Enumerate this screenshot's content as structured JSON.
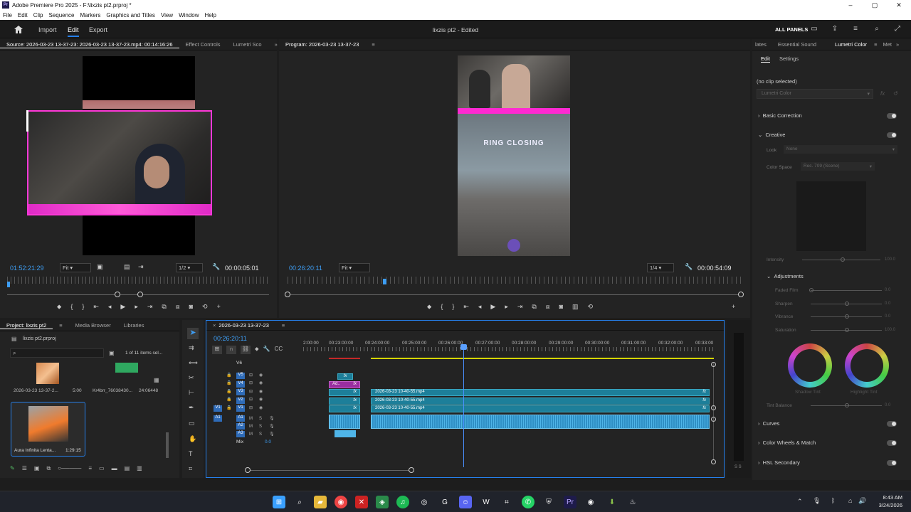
{
  "titlebar": {
    "title": "Adobe Premiere Pro 2025 - F:\\lixzis pt2.prproj *"
  },
  "menu": [
    "File",
    "Edit",
    "Clip",
    "Sequence",
    "Markers",
    "Graphics and Titles",
    "View",
    "Window",
    "Help"
  ],
  "header": {
    "nav": [
      "Import",
      "Edit",
      "Export"
    ],
    "project_title": "lixzis pt2 - Edited",
    "all_panels": "ALL PANELS"
  },
  "source_panel": {
    "tabs": [
      "Source: 2026-03-23 13-37-23: 2026-03-23 13-37-23.mp4: 00:14:16:26",
      "Effect Controls",
      "Lumetri Sco"
    ],
    "timecode": "01:52:21:29",
    "fit": "Fit",
    "resolution": "1/2",
    "duration": "00:00:05:01"
  },
  "program_panel": {
    "tab": "Program: 2026-03-23 13-37-23",
    "timecode": "00:26:20:11",
    "fit": "Fit",
    "resolution": "1/4",
    "duration": "00:00:54:09",
    "overlay_text": "RING CLOSING"
  },
  "lumetri": {
    "tabs": [
      "lates",
      "Essential Sound",
      "Lumetri Color",
      "Met"
    ],
    "subtabs": [
      "Edit",
      "Settings"
    ],
    "no_clip": "(no clip selected)",
    "effect_select": "Lumetri Color",
    "sections": {
      "basic_correction": "Basic Correction",
      "creative": "Creative",
      "look_label": "Look",
      "look_value": "None",
      "color_space_label": "Color Space",
      "color_space_value": "Rec. 709 (Scene)",
      "intensity": "Intensity",
      "intensity_value": "100.0",
      "adjustments": "Adjustments",
      "faded_film": "Faded Film",
      "faded_film_value": "0.0",
      "sharpen": "Sharpen",
      "sharpen_value": "0.0",
      "vibrance": "Vibrance",
      "vibrance_value": "0.0",
      "saturation": "Saturation",
      "saturation_value": "100.0",
      "shadow_tint": "Shadow Tint",
      "highlight_tint": "Highlight Tint",
      "tint_balance": "Tint Balance",
      "tint_balance_value": "0.0",
      "curves": "Curves",
      "color_wheels": "Color Wheels & Match",
      "hsl": "HSL Secondary"
    }
  },
  "project_panel": {
    "tabs": [
      "Project: lixzis pt2",
      "Media Browser",
      "Libraries"
    ],
    "file": "lixzis pt2.prproj",
    "count": "1 of 11 items sel...",
    "items": [
      {
        "name": "2026-03-23 13-37-2...",
        "duration": "5:00"
      },
      {
        "name": "Kr4brr_76038430...",
        "duration": "24:06448"
      },
      {
        "name": "Aura Infinita Lenta...",
        "duration": "1:29:15"
      }
    ]
  },
  "timeline": {
    "tab": "2026-03-23 13-37-23",
    "timecode": "00:26:20:11",
    "ruler": [
      "2:00:00",
      "00:23:00:00",
      "00:24:00:00",
      "00:25:00:00",
      "00:26:00:00",
      "00:27:00:00",
      "00:28:00:00",
      "00:29:00:00",
      "00:30:00:00",
      "00:31:00:00",
      "00:32:00:00",
      "00:33:00"
    ],
    "video_tracks": [
      "V6",
      "V5",
      "V4",
      "V3",
      "V2",
      "V1"
    ],
    "audio_tracks": [
      "A1",
      "A2",
      "A3"
    ],
    "mix_label": "Mix",
    "mix_value": "0.0",
    "clip_name": "2026-03-23 10-40-55.mp4",
    "adj_label": "Ad..",
    "fx": "fx"
  },
  "taskbar": {
    "time": "8:43 AM",
    "date": "3/24/2026"
  }
}
